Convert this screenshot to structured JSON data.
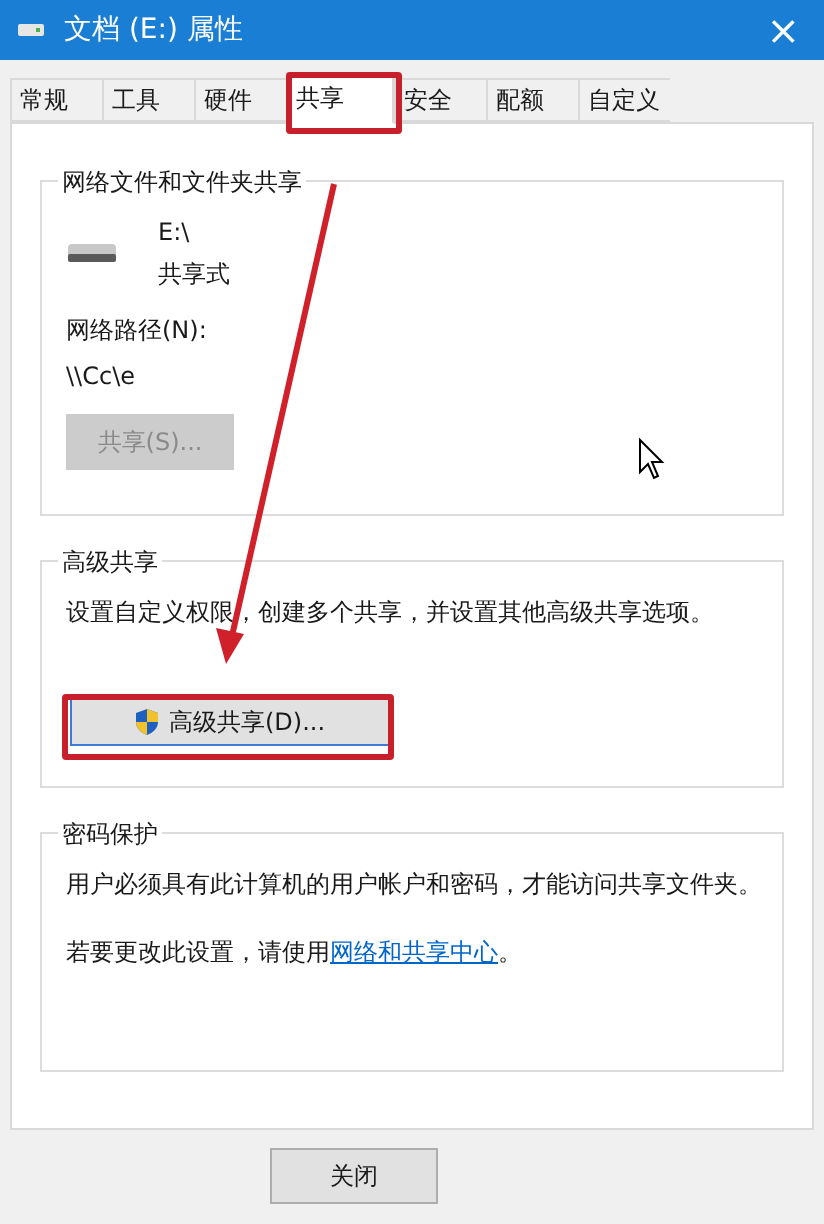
{
  "window": {
    "title": "文档 (E:) 属性",
    "close": "×"
  },
  "tabs": [
    {
      "label": "常规",
      "selected": false
    },
    {
      "label": "工具",
      "selected": false
    },
    {
      "label": "硬件",
      "selected": false
    },
    {
      "label": "共享",
      "selected": true
    },
    {
      "label": "安全",
      "selected": false
    },
    {
      "label": "配额",
      "selected": false
    },
    {
      "label": "自定义",
      "selected": false
    }
  ],
  "network_sharing": {
    "title": "网络文件和文件夹共享",
    "drive": "E:\\",
    "status": "共享式",
    "path_label": "网络路径(N):",
    "path": "\\\\Cc\\e",
    "share_button": {
      "label": "共享(S)...",
      "disabled": true
    }
  },
  "advanced_sharing": {
    "title": "高级共享",
    "description": "设置自定义权限，创建多个共享，并设置其他高级共享选项。",
    "button": "高级共享(D)..."
  },
  "password_protection": {
    "title": "密码保护",
    "description": "用户必须具有此计算机的用户帐户和密码，才能访问共享文件夹。",
    "hint": "若要更改此设置，请使用",
    "link": "网络和共享中心",
    "hint_end": "。"
  },
  "buttons": [
    "关闭"
  ]
}
